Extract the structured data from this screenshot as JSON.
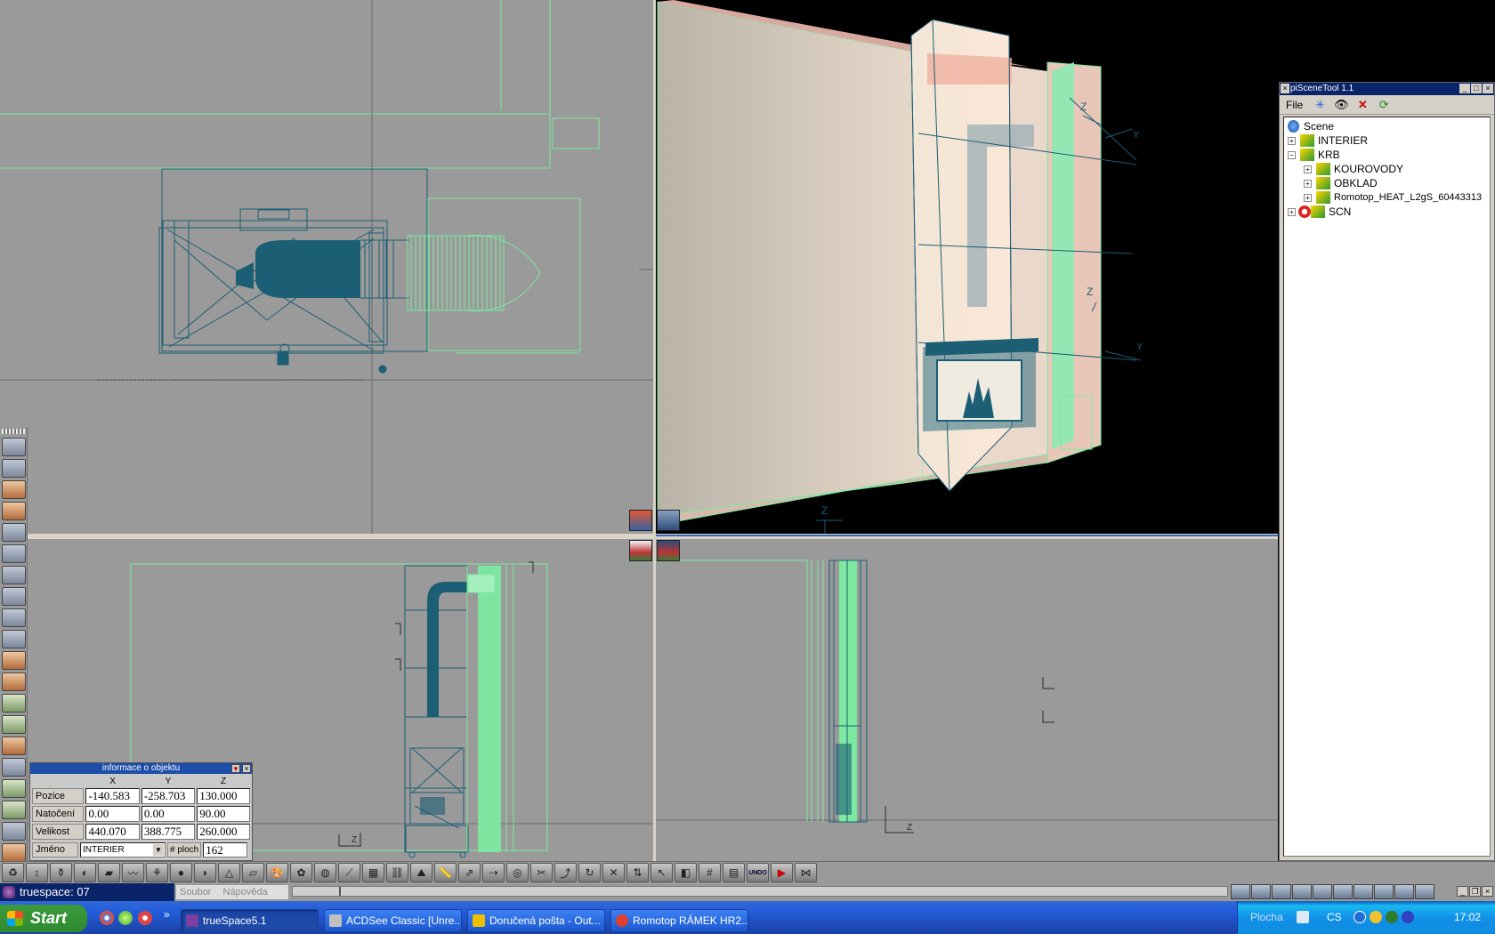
{
  "window_title": "truespace: 07",
  "scene_tool": {
    "title": "piSceneTool 1.1",
    "file_menu": "File",
    "tree": [
      {
        "label": "Scene",
        "level": 0,
        "expander": ""
      },
      {
        "label": "INTERIER",
        "level": 1,
        "expander": "+"
      },
      {
        "label": "KRB",
        "level": 1,
        "expander": "−"
      },
      {
        "label": "KOUROVODY",
        "level": 2,
        "expander": "+"
      },
      {
        "label": "OBKLAD",
        "level": 2,
        "expander": "+"
      },
      {
        "label": "Romotop_HEAT_L2gS_60443313",
        "level": 2,
        "expander": "+"
      },
      {
        "label": "SCN",
        "level": 1,
        "expander": "+"
      }
    ]
  },
  "info_panel": {
    "title": "informace o objektu",
    "columns": [
      "X",
      "Y",
      "Z"
    ],
    "rows": [
      {
        "label": "Pozice",
        "values": [
          "-140.583",
          "-258.703",
          "130.000"
        ]
      },
      {
        "label": "Natočení",
        "values": [
          "0.00",
          "0.00",
          "90.00"
        ]
      },
      {
        "label": "Velikost",
        "values": [
          "440.070",
          "388.775",
          "260.000"
        ]
      }
    ],
    "name_label": "Jméno",
    "name_value": "INTERIER",
    "faces_label": "# ploch",
    "faces_value": "162"
  },
  "axis_labels": {
    "z": "Z",
    "y": "Y"
  },
  "status_menu": [
    "Soubor",
    "Nápověda"
  ],
  "undo_label": "UNDO",
  "taskbar": {
    "start": "Start",
    "items": [
      {
        "label": "trueSpace5.1",
        "icon_color": "#7b3fa0"
      },
      {
        "label": "ACDSee Classic [Unre...",
        "icon_color": "#c0c0c0"
      },
      {
        "label": "Doručená pošta - Out...",
        "icon_color": "#f0c000"
      },
      {
        "label": "Romotop RÁMEK HR2...",
        "icon_color": "#e04030"
      }
    ],
    "tray_label": "Plocha",
    "language": "CS",
    "clock": "17:02",
    "more": "»"
  },
  "colors": {
    "viewport_gray": "#9a9a9a",
    "wire_teal": "#1c5e74",
    "selection_green": "#7de8a0",
    "title_blue": "#0a246a"
  }
}
